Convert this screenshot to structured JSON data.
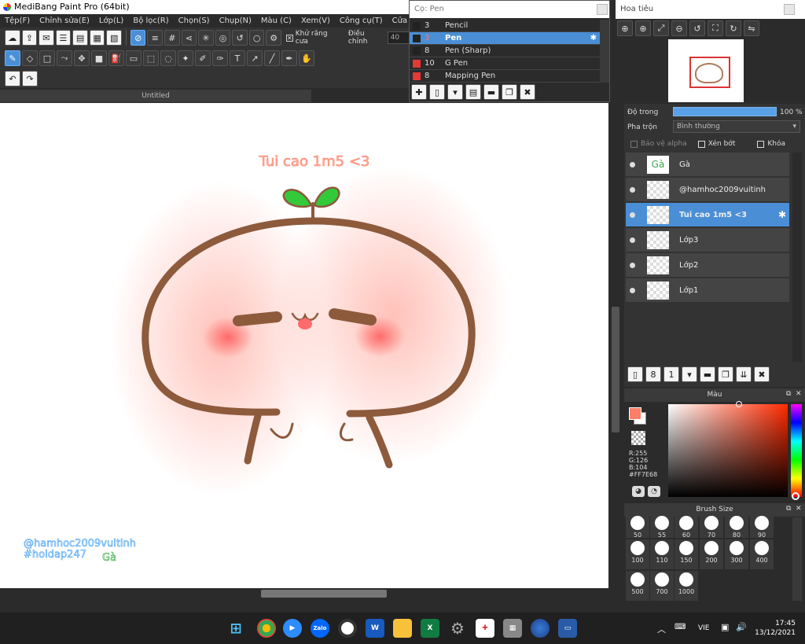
{
  "app": {
    "title": "MediBang Paint Pro (64bit)"
  },
  "menu": [
    "Tệp(F)",
    "Chỉnh sửa(E)",
    "Lớp(L)",
    "Bộ lọc(R)",
    "Chọn(S)",
    "Chụp(N)",
    "Màu (C)",
    "Xem(V)",
    "Công cụ(T)",
    "Cửa sổ(W)",
    "Cử"
  ],
  "toolbar": {
    "antialias_label": "Khử răng cưa",
    "adjust_label": "Điều chỉnh",
    "adjust_value": "40"
  },
  "document": {
    "tab_title": "Untitled"
  },
  "canvas_texts": {
    "title": "Tui cao 1m5   <3",
    "watermark1": "@hamhoc2009vuitinh",
    "watermark2": "#hoidap247",
    "signature": "Gà"
  },
  "brush_panel": {
    "title": "Cọ: Pen",
    "items": [
      {
        "size": "3",
        "name": "Pencil",
        "color": "#222222"
      },
      {
        "size": "3",
        "name": "Pen",
        "color": "#222222",
        "selected": true
      },
      {
        "size": "8",
        "name": "Pen (Sharp)",
        "color": "#222222"
      },
      {
        "size": "10",
        "name": "G Pen",
        "color": "#e53935"
      },
      {
        "size": "8",
        "name": "Mapping Pen",
        "color": "#e53935"
      }
    ]
  },
  "navigator": {
    "title": "Hoa tiêu"
  },
  "layers_panel": {
    "opacity_label": "Độ trong",
    "opacity_value": "100 %",
    "blend_label": "Pha trộn",
    "blend_value": "Bình thường",
    "protect_alpha_label": "Bảo vệ alpha",
    "clipping_label": "Xén bớt",
    "lock_label": "Khóa",
    "layers": [
      {
        "name": "Gà"
      },
      {
        "name": "@hamhoc2009vuitinh"
      },
      {
        "name": "Tui cao 1m5   <3",
        "selected": true
      },
      {
        "name": "Lớp3"
      },
      {
        "name": "Lớp2"
      },
      {
        "name": "Lớp1"
      }
    ]
  },
  "color_panel": {
    "title": "Màu",
    "r": "R:255",
    "g": "G:126",
    "b": "B:104",
    "hex": "#FF7E68",
    "fg_color": "#ff7e68"
  },
  "brush_size_panel": {
    "title": "Brush Size",
    "sizes": [
      "50",
      "55",
      "60",
      "70",
      "80",
      "90",
      "100",
      "110",
      "150",
      "200",
      "300",
      "400",
      "500",
      "700",
      "1000"
    ]
  },
  "taskbar": {
    "language": "VIE",
    "time": "17:45",
    "date": "13/12/2021"
  }
}
